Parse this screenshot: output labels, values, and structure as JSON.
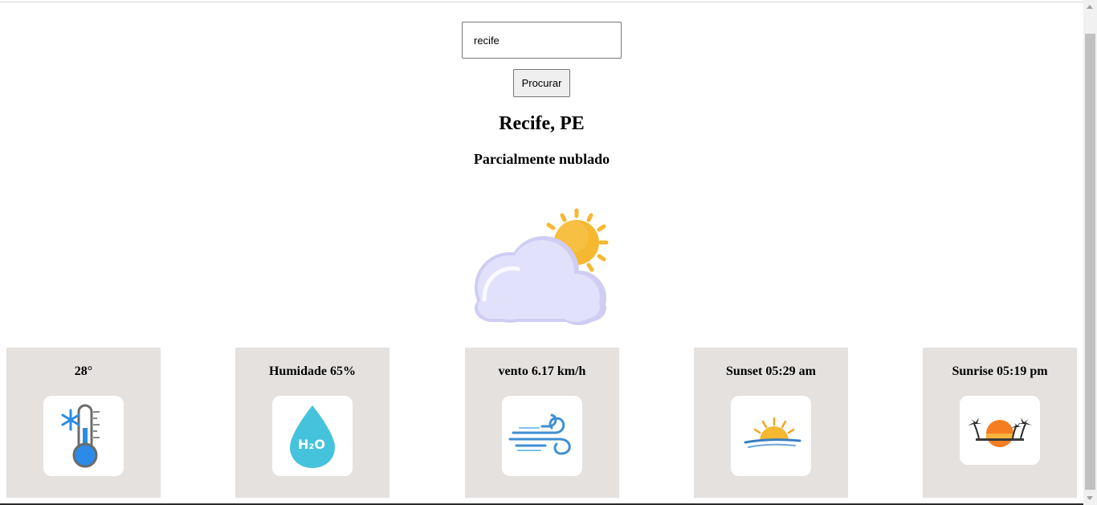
{
  "search": {
    "value": "recife",
    "button_label": "Procurar"
  },
  "location": {
    "title": "Recife, PE",
    "condition": "Parcialmente nublado"
  },
  "icons": {
    "weather": "partly-cloudy-icon"
  },
  "cards": [
    {
      "label": "28°",
      "icon": "thermometer-icon"
    },
    {
      "label": "Humidade 65%",
      "icon": "water-drop-icon"
    },
    {
      "label": "vento 6.17 km/h",
      "icon": "wind-icon"
    },
    {
      "label": "Sunset 05:29 am",
      "icon": "sunset-icon"
    },
    {
      "label": "Sunrise 05:19 pm",
      "icon": "sunrise-icon"
    }
  ],
  "colors": {
    "card_bg": "#e4e1df",
    "sun": "#f6b731",
    "cloud": "#e2e1fb",
    "drop": "#46c3dc",
    "wind": "#3e8fd3"
  }
}
